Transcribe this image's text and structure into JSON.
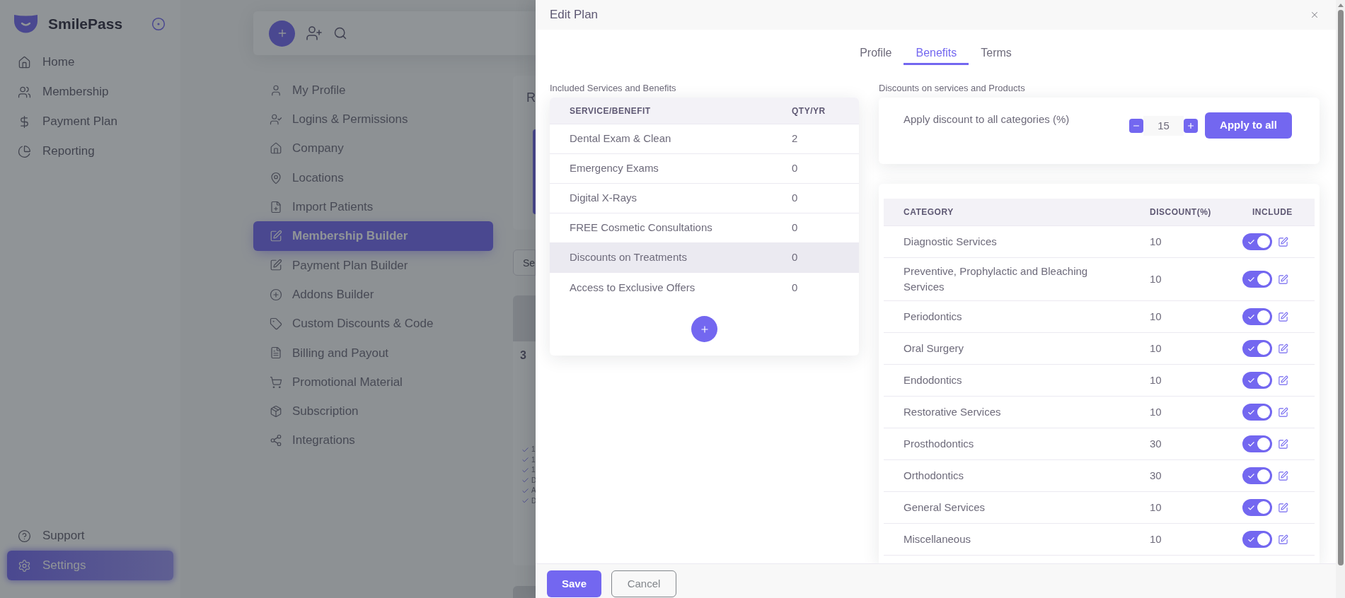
{
  "sidebar": {
    "brand": "SmilePass",
    "nav": [
      {
        "label": "Home",
        "selected": false
      },
      {
        "label": "Membership",
        "selected": false
      },
      {
        "label": "Payment Plan",
        "selected": false
      },
      {
        "label": "Reporting",
        "selected": false
      }
    ],
    "bottom_nav": [
      {
        "label": "Support",
        "selected": false
      },
      {
        "label": "Settings",
        "selected": true
      }
    ]
  },
  "settings_menu": {
    "items": [
      {
        "label": "My Profile",
        "selected": false
      },
      {
        "label": "Logins & Permissions",
        "selected": false
      },
      {
        "label": "Company",
        "selected": false
      },
      {
        "label": "Locations",
        "selected": false
      },
      {
        "label": "Import Patients",
        "selected": false
      },
      {
        "label": "Membership Builder",
        "selected": true
      },
      {
        "label": "Payment Plan Builder",
        "selected": false
      },
      {
        "label": "Addons Builder",
        "selected": false
      },
      {
        "label": "Custom Discounts & Code",
        "selected": false
      },
      {
        "label": "Billing and Payout",
        "selected": false
      },
      {
        "label": "Promotional Material",
        "selected": false
      },
      {
        "label": "Subscription",
        "selected": false
      },
      {
        "label": "Integrations",
        "selected": false
      }
    ]
  },
  "background_panel": {
    "card_heading": "R",
    "search": {
      "placeholder": "Se"
    },
    "plan_card": {
      "price": "3",
      "features": [
        "1",
        "1",
        "1",
        "D",
        "A",
        "D"
      ]
    }
  },
  "modal": {
    "title": "Edit Plan",
    "tabs": [
      {
        "label": "Profile",
        "selected": false
      },
      {
        "label": "Benefits",
        "selected": true
      },
      {
        "label": "Terms",
        "selected": false
      }
    ],
    "benefits": {
      "heading": "Included Services and Benefits",
      "columns": [
        "SERVICE/BENEFIT",
        "QTY/YR"
      ],
      "rows": [
        {
          "service": "Dental Exam & Clean",
          "qty": "2",
          "highlighted": false
        },
        {
          "service": "Emergency Exams",
          "qty": "0",
          "highlighted": false
        },
        {
          "service": "Digital X-Rays",
          "qty": "0",
          "highlighted": false
        },
        {
          "service": "FREE Cosmetic Consultations",
          "qty": "0",
          "highlighted": false
        },
        {
          "service": "Discounts on Treatments",
          "qty": "0",
          "highlighted": true
        },
        {
          "service": "Access to Exclusive Offers",
          "qty": "0",
          "highlighted": false
        }
      ]
    },
    "discounts": {
      "heading": "Discounts on services and Products",
      "apply_label": "Apply discount to all categories (%)",
      "apply_value": "15",
      "apply_button": "Apply to all",
      "columns": [
        "CATEGORY",
        "DISCOUNT(%)",
        "INCLUDE"
      ],
      "rows": [
        {
          "category": "Diagnostic Services",
          "discount": "10",
          "included": true
        },
        {
          "category": "Preventive, Prophylactic and Bleaching Services",
          "discount": "10",
          "included": true
        },
        {
          "category": "Periodontics",
          "discount": "10",
          "included": true
        },
        {
          "category": "Oral Surgery",
          "discount": "10",
          "included": true
        },
        {
          "category": "Endodontics",
          "discount": "10",
          "included": true
        },
        {
          "category": "Restorative Services",
          "discount": "10",
          "included": true
        },
        {
          "category": "Prosthodontics",
          "discount": "30",
          "included": true
        },
        {
          "category": "Orthodontics",
          "discount": "30",
          "included": true
        },
        {
          "category": "General Services",
          "discount": "10",
          "included": true
        },
        {
          "category": "Miscellaneous",
          "discount": "10",
          "included": true
        }
      ]
    },
    "footer_buttons": [
      {
        "label": "Save",
        "kind": "primary"
      },
      {
        "label": "Cancel",
        "kind": "secondary"
      }
    ]
  }
}
